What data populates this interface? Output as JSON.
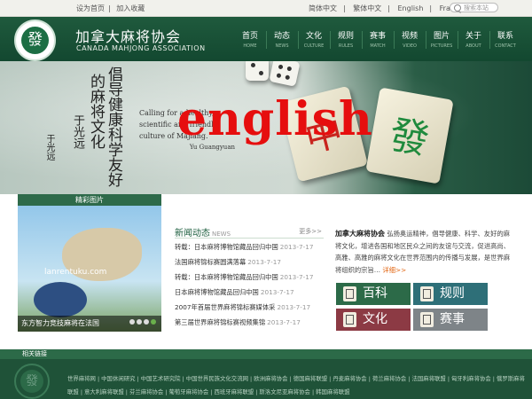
{
  "topbar": {
    "links": [
      "设为首页",
      "加入收藏"
    ],
    "languages": [
      "简体中文",
      "繁体中文",
      "English",
      "França"
    ],
    "search_placeholder": "搜索本站"
  },
  "header": {
    "logo_char": "發",
    "org_name_cn": "加拿大麻将协会",
    "org_name_en": "CANADA MAHJONG ASSOCIATION",
    "nav": [
      {
        "cn": "首页",
        "en": "HOME"
      },
      {
        "cn": "动态",
        "en": "NEWS"
      },
      {
        "cn": "文化",
        "en": "CULTURE"
      },
      {
        "cn": "规则",
        "en": "RULES"
      },
      {
        "cn": "赛事",
        "en": "MATCH"
      },
      {
        "cn": "视频",
        "en": "VIDEO"
      },
      {
        "cn": "图片",
        "en": "PICTURES"
      },
      {
        "cn": "关于",
        "en": "ABOUT"
      },
      {
        "cn": "联系",
        "en": "CONTACT"
      }
    ]
  },
  "banner": {
    "calligraphy": [
      "倡导健康科学友好",
      "的麻将文化",
      "于光远"
    ],
    "signature": "于光远",
    "quote_lines": [
      "Calling for a healthy,",
      "scientific and friendly",
      "culture of Majiang."
    ],
    "quote_author": "Yu Guangyuan",
    "tile_1": "中",
    "tile_2": "發",
    "overlay_text": "english"
  },
  "gallery": {
    "heading": "精彩图片",
    "watermark": "lanrentuku.com",
    "caption": "东方智力竞技麻将在法国"
  },
  "news": {
    "title": "新闻动态",
    "title_en": "NEWS",
    "more": "更多>>",
    "items": [
      {
        "text": "转载：日本麻将博物馆藏品回归中国",
        "date": "2013-7-17"
      },
      {
        "text": "法国麻将锦标赛圆满落幕",
        "date": "2013-7-17"
      },
      {
        "text": "转载：日本麻将博物馆藏品回归中国",
        "date": "2013-7-17"
      },
      {
        "text": "日本麻将博物馆藏品回归中国",
        "date": "2013-7-17"
      },
      {
        "text": "2007年首届世界麻将锦标赛媒体采",
        "date": "2013-7-17"
      },
      {
        "text": "第三届世界麻将锦标赛视频集锦",
        "date": "2013-7-17"
      }
    ]
  },
  "intro": {
    "name": "加拿大麻将协会",
    "text": "弘扬奥运精神，倡导健康、科学、友好的麻将文化，增进各国和地区民众之间的友谊与交流，促进高尚、高雅、高雅的麻将文化在世界范围内的传播与发展，是世界麻将组织的宗旨…",
    "read_more": "详细>>"
  },
  "categories": [
    {
      "label": "百科",
      "color": "#2c6a48"
    },
    {
      "label": "规则",
      "color": "#2e6f78"
    },
    {
      "label": "文化",
      "color": "#8c3a44"
    },
    {
      "label": "赛事",
      "color": "#7e8488"
    }
  ],
  "footer": {
    "bar_label": "相关链接",
    "logo_char": "發",
    "links": [
      "世界麻将网",
      "中国休闲研究",
      "中国艺术研究院",
      "中国世界民族文化交流网",
      "欧洲麻将协会",
      "德国麻将联盟",
      "丹麦麻将协会",
      "荷兰麻将协会",
      "法国麻将联盟",
      "匈牙利麻将协会",
      "俄罗斯麻将联盟",
      "意大利麻将联盟",
      "芬兰麻将协会",
      "葡萄牙麻将协会",
      "西班牙麻将联盟",
      "斯洛文尼亚麻将协会",
      "韩国麻将联盟"
    ]
  }
}
